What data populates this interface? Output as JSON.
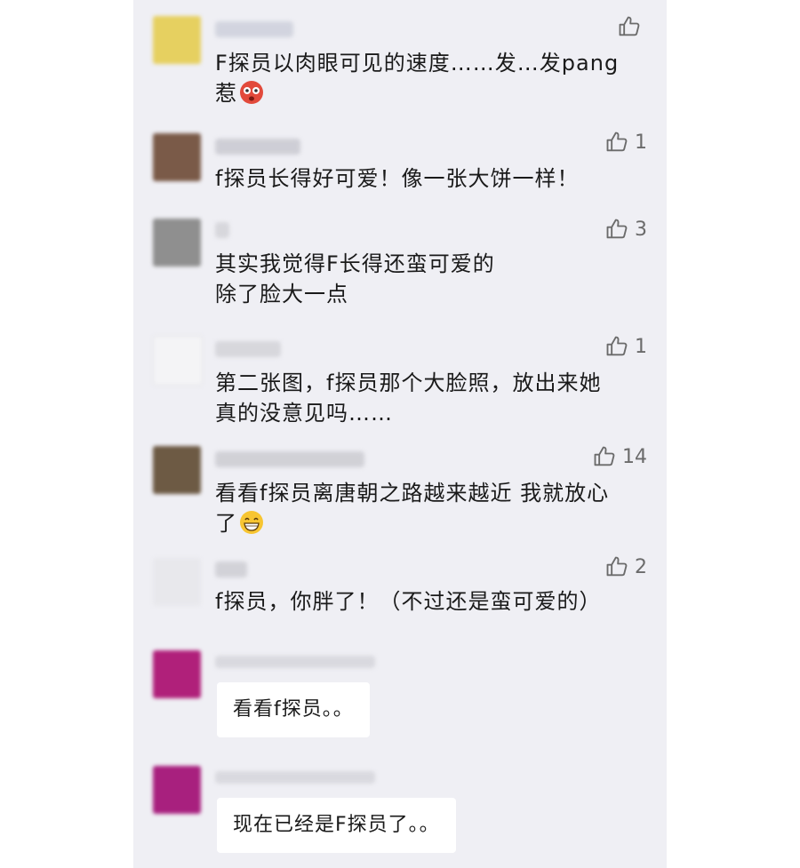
{
  "comments": [
    {
      "likes": "",
      "text": "F探员以肉眼可见的速度……发…发pang",
      "text2": "惹",
      "emoji": "dizzy-face-emoji",
      "avatar_color": "#e6d060",
      "name_color": "#c9ccd8"
    },
    {
      "likes": "1",
      "text": "f探员长得好可爱！像一张大饼一样！",
      "avatar_color": "#7a5a48",
      "name_color": "#c4c4cc"
    },
    {
      "likes": "3",
      "text": "其实我觉得F长得还蛮可爱的",
      "text2": "除了脸大一点",
      "avatar_color": "#8f8f8f",
      "name_color": "#cfcfd4"
    },
    {
      "likes": "1",
      "text": "第二张图，f探员那个大脸照，放出来她",
      "text2": "真的没意见吗……",
      "avatar_color": "#f4f4f6",
      "name_color": "#cfcfd4"
    },
    {
      "likes": "14",
      "text": "看看f探员离唐朝之路越来越近 我就放心",
      "text2": "了",
      "emoji": "grinning-face-emoji",
      "avatar_color": "#6d5a44",
      "name_color": "#c7c7cd"
    },
    {
      "likes": "2",
      "text": "f探员，你胖了！（不过还是蛮可爱的）",
      "avatar_color": "#e8e8ec",
      "name_color": "#c9c9cf"
    }
  ],
  "replies": [
    {
      "text": "看看f探员。。",
      "avatar_color": "#b0207a",
      "name_color": "#d2d2d8"
    },
    {
      "text": "现在已经是F探员了。。",
      "avatar_color": "#a8207e",
      "name_color": "#d2d2d8"
    }
  ],
  "icons": {
    "like": "thumbs-up-icon"
  }
}
